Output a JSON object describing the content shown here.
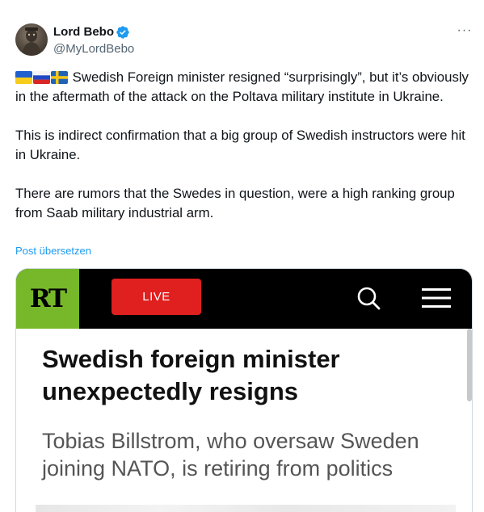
{
  "tweet": {
    "author": {
      "display_name": "Lord Bebo",
      "handle": "@MyLordBebo",
      "verified": true
    },
    "more_label": "···",
    "flags": [
      "flag-ukraine",
      "flag-russia",
      "flag-sweden"
    ],
    "paragraphs": [
      "Swedish Foreign minister resigned “surprisingly”, but it’s obviously in the aftermath of the attack on the Poltava military institute in Ukraine.",
      "This is indirect confirmation that a big group of Swedish instructors were hit in Ukraine.",
      "There are rumors that the Swedes in question, were a high ranking group from Saab military industrial arm."
    ],
    "translate_label": "Post übersetzen"
  },
  "media": {
    "site_logo_text": "RT",
    "live_label": "LIVE",
    "headline": "Swedish foreign minister unexpectedly resigns",
    "subheadline": "Tobias Billstrom, who oversaw Sweden joining NATO, is retiring from politics",
    "colors": {
      "logo_green": "#77b82a",
      "live_red": "#e01f1f",
      "bar_black": "#000000"
    }
  },
  "colors": {
    "link_blue": "#1d9bf0",
    "verified_blue": "#1d9bf0",
    "secondary_text": "#536471"
  }
}
